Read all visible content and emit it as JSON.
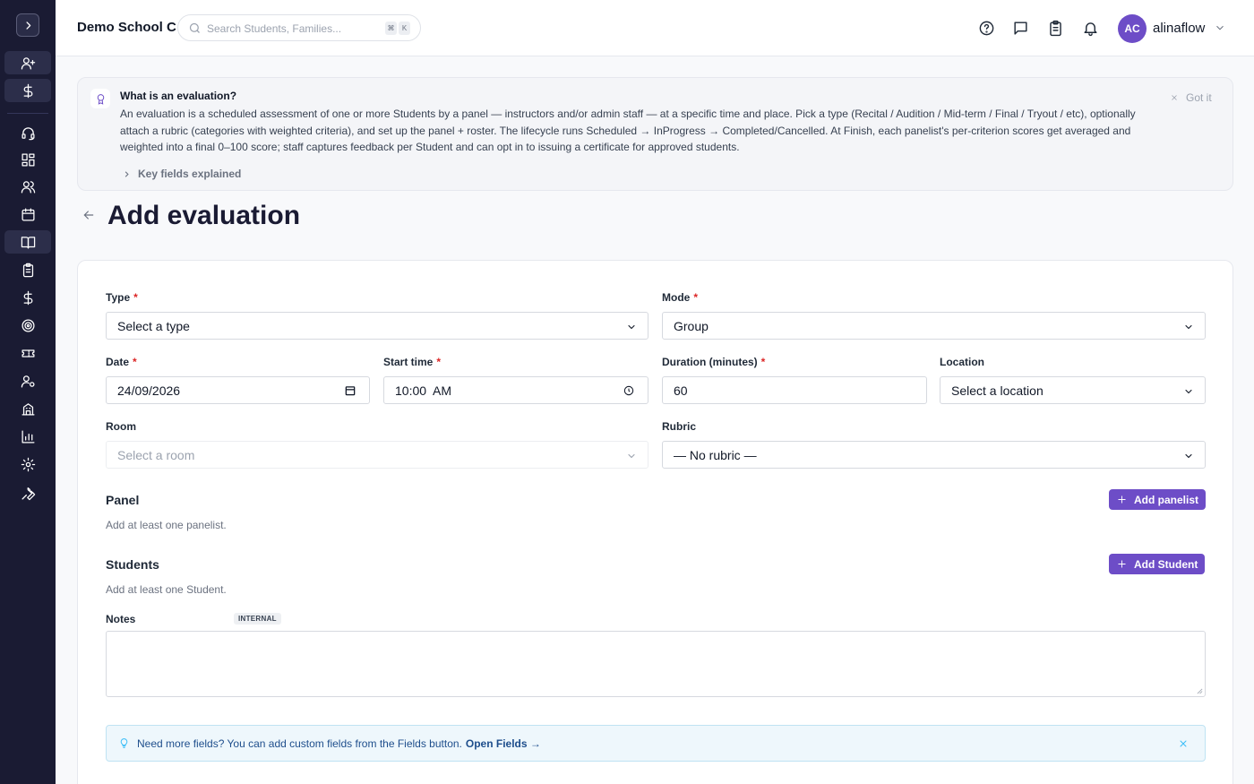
{
  "header": {
    "school_name": "Demo School C",
    "search_placeholder": "Search Students, Families...",
    "kbd_keys": [
      "⌘",
      "K"
    ],
    "username": "alinaflow",
    "avatar_initials": "AC",
    "icons": [
      "help-icon",
      "messages-icon",
      "clipboard-icon",
      "bell-icon"
    ]
  },
  "sidebar": {
    "icons": [
      "add-user-icon",
      "dollar-icon",
      "headset-icon",
      "dashboard-icon",
      "users-icon",
      "calendar-icon",
      "book-icon",
      "clipboard-icon",
      "dollar-icon",
      "target-icon",
      "ticket-icon",
      "user-settings-icon",
      "building-icon",
      "chart-icon",
      "gear-icon",
      "wrench-icon"
    ],
    "active": "book-icon"
  },
  "banner": {
    "title": "What is an evaluation?",
    "text": "An evaluation is a scheduled assessment of one or more Students by a panel — instructors and/or admin staff — at a specific time and place. Pick a type (Recital / Audition / Mid-term / Final / Tryout / etc), optionally attach a rubric (categories with weighted criteria), and set up the panel + roster. The lifecycle runs Scheduled → InProgress → Completed/Cancelled. At Finish, each panelist's per-criterion scores get averaged and weighted into a final 0–100 score; staff captures feedback per Student and can opt in to issuing a certificate for approved students.",
    "dismiss_label": "Got it",
    "key_fields_label": "Key fields explained"
  },
  "page": {
    "title": "Add evaluation"
  },
  "form": {
    "type": {
      "label": "Type",
      "value": "Select a type"
    },
    "mode": {
      "label": "Mode",
      "value": "Group"
    },
    "date": {
      "label": "Date",
      "value": "24/09/2026"
    },
    "start_time": {
      "label": "Start time",
      "value": "10:00  AM"
    },
    "duration": {
      "label": "Duration (minutes)",
      "value": "60"
    },
    "location": {
      "label": "Location",
      "value": "Select a location"
    },
    "room": {
      "label": "Room",
      "value": "Select a room"
    },
    "rubric": {
      "label": "Rubric",
      "value": "— No rubric —"
    },
    "panel": {
      "title": "Panel",
      "hint": "Add at least one panelist.",
      "button": "Add panelist"
    },
    "students": {
      "title": "Students",
      "hint": "Add at least one Student.",
      "button": "Add Student"
    },
    "notes": {
      "label": "Notes",
      "badge": "INTERNAL",
      "value": ""
    },
    "required_mark": "*"
  },
  "tip": {
    "text": "Need more fields? You can add custom fields from the Fields button.",
    "link": "Open Fields →"
  },
  "colors": {
    "sidebar_bg": "#1a1b33",
    "accent": "#6d4dc7",
    "required": "#dc2626",
    "tip_bg": "#eef7fc"
  }
}
